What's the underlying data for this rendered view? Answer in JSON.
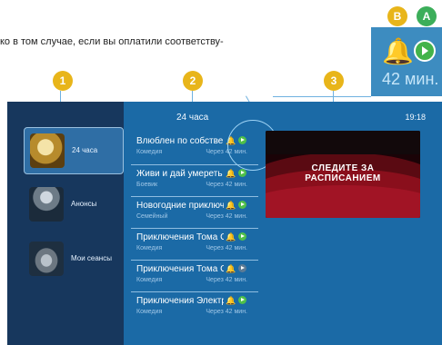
{
  "top_text": "ко в том случае, если вы оплатили соответству-",
  "badges": {
    "a": "A",
    "b": "B",
    "one": "1",
    "two": "2",
    "three": "3"
  },
  "zoom": {
    "time": "42 мин."
  },
  "header": {
    "title": "24 часа",
    "time": "19:18"
  },
  "left_menu": [
    {
      "label": "24 часа",
      "icon": "globe-icon"
    },
    {
      "label": "Анонсы",
      "icon": "character-icon"
    },
    {
      "label": "Мои сеансы",
      "icon": "cloud-icon"
    }
  ],
  "programs": [
    {
      "title": "Влюблен по собствен",
      "genre": "Комедия",
      "when": "Через 42 мин."
    },
    {
      "title": "Живи и дай умереть I",
      "genre": "Боевик",
      "when": "Через 42 мин."
    },
    {
      "title": "Новогодние приключ",
      "genre": "Семейный",
      "when": "Через 42 мин."
    },
    {
      "title": "Приключения Тома С",
      "genre": "Комедия",
      "when": "Через 42 мин."
    },
    {
      "title": "Приключения Тома С",
      "genre": "Комедия",
      "when": "Через 42 мин."
    },
    {
      "title": "Приключения Электр",
      "genre": "Комедия",
      "when": "Через 42 мин."
    }
  ],
  "preview": {
    "line1": "СЛЕДИТЕ ЗА",
    "line2": "РАСПИСАНИЕМ"
  },
  "colors": {
    "accent_yellow": "#e8b51a",
    "accent_green": "#3cae5a",
    "screen_blue": "#1b6aa6"
  }
}
